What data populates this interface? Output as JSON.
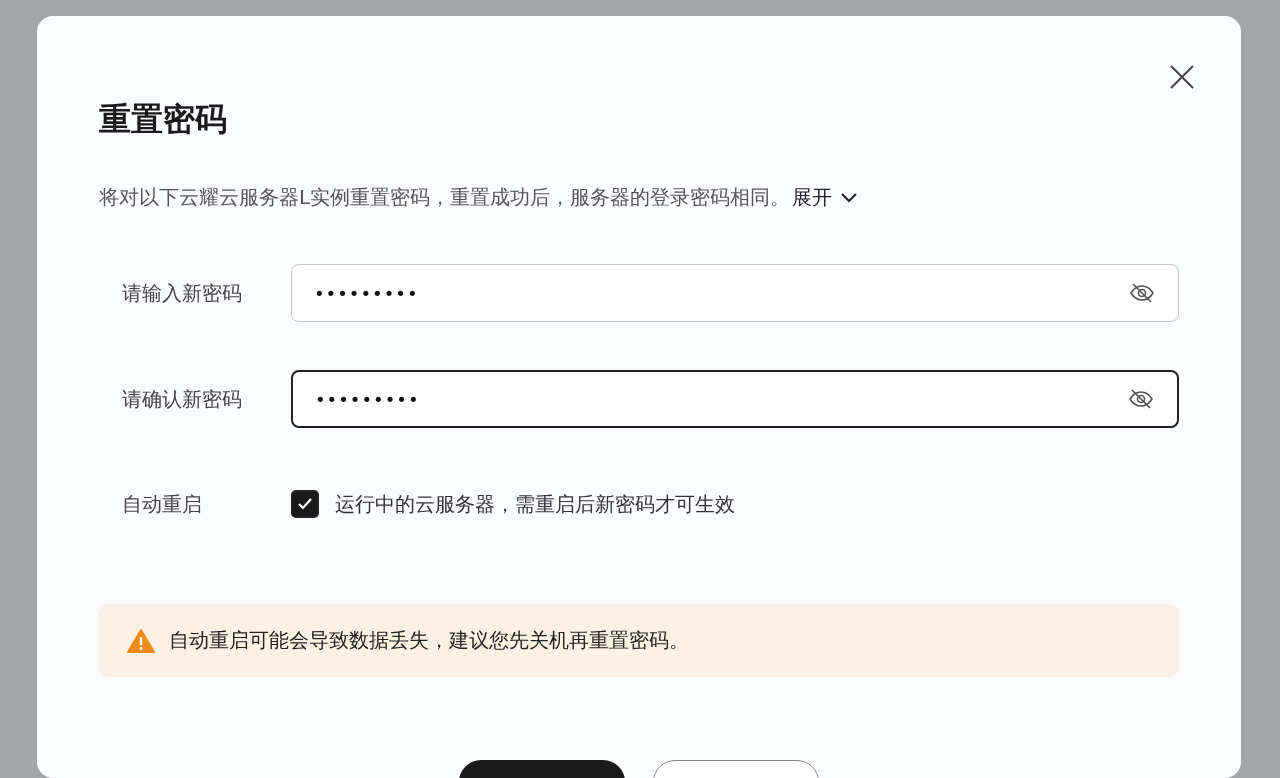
{
  "dialog": {
    "title": "重置密码",
    "description": "将对以下云耀云服务器L实例重置密码，重置成功后，服务器的登录密码相同。",
    "expand_link": "展开"
  },
  "fields": [
    {
      "label": "请输入新密码",
      "value": "•••••••••",
      "focused": false
    },
    {
      "label": "请确认新密码",
      "value": "•••••••••",
      "focused": true
    }
  ],
  "auto_restart": {
    "label": "自动重启",
    "checkbox_text": "运行中的云服务器，需重启后新密码才可生效",
    "checked": true
  },
  "warning": {
    "text": "自动重启可能会导致数据丢失，建议您先关机再重置密码。"
  },
  "buttons": [
    {
      "kind": "primary"
    },
    {
      "kind": "secondary"
    }
  ]
}
